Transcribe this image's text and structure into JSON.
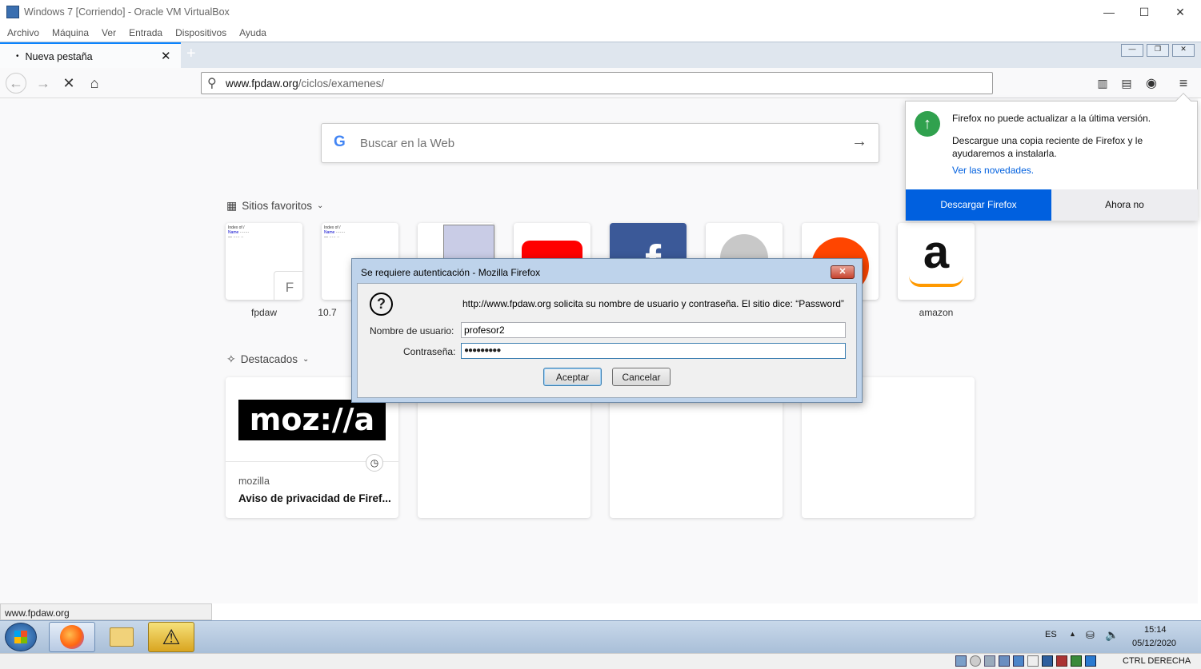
{
  "vbox": {
    "title": "Windows 7  [Corriendo] - Oracle VM VirtualBox",
    "menu": [
      "Archivo",
      "Máquina",
      "Ver",
      "Entrada",
      "Dispositivos",
      "Ayuda"
    ],
    "host_key": "CTRL DERECHA"
  },
  "firefox": {
    "tab_title": "Nueva pestaña",
    "url_domain": "www.fpdaw.org",
    "url_path": "/ciclos/examenes/",
    "search_placeholder": "Buscar en la Web",
    "top_sites_heading": "Sitios favoritos",
    "highlights_heading": "Destacados",
    "top_sites": [
      {
        "label": "fpdaw",
        "letter": "F"
      },
      {
        "label": "10.7"
      },
      {
        "label": ""
      },
      {
        "label": ""
      },
      {
        "label": ""
      },
      {
        "label": ""
      },
      {
        "label": ""
      },
      {
        "label": "amazon"
      }
    ],
    "highlight": {
      "source": "mozilla",
      "title": "Aviso de privacidad de Firef...",
      "logo_text": "moz://a"
    },
    "status_url": "www.fpdaw.org"
  },
  "doorhanger": {
    "line1": "Firefox no puede actualizar a la última versión.",
    "line2": "Descargue una copia reciente de Firefox y le ayudaremos a instalarla.",
    "link": "Ver las novedades.",
    "primary": "Descargar Firefox",
    "secondary": "Ahora no"
  },
  "auth_dialog": {
    "title": "Se requiere autenticación - Mozilla Firefox",
    "message": "http://www.fpdaw.org solicita su nombre de usuario y contraseña. El sitio dice: “Password”",
    "user_label": "Nombre de usuario:",
    "user_value": "profesor2",
    "pass_label": "Contraseña:",
    "pass_value": "●●●●●●●●●",
    "ok": "Aceptar",
    "cancel": "Cancelar"
  },
  "tray": {
    "lang": "ES",
    "time": "15:14",
    "date": "05/12/2020"
  },
  "colors": {
    "accent": "#0a84ff",
    "primary_button": "#0060df",
    "update_green": "#30a14e"
  }
}
